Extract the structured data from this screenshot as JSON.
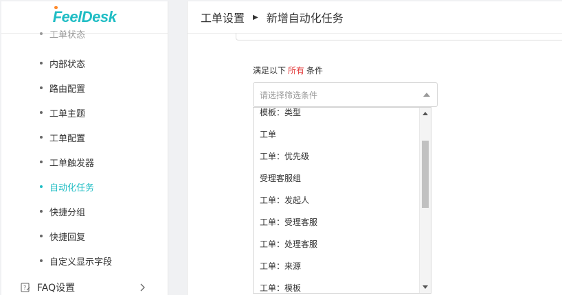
{
  "app": {
    "logo_text": "FeelDesk"
  },
  "sidebar": {
    "partial_item": "工单状态",
    "items": [
      {
        "label": "内部状态"
      },
      {
        "label": "路由配置"
      },
      {
        "label": "工单主题"
      },
      {
        "label": "工单配置"
      },
      {
        "label": "工单触发器"
      },
      {
        "label": "自动化任务",
        "active": true
      },
      {
        "label": "快捷分组"
      },
      {
        "label": "快捷回复"
      },
      {
        "label": "自定义显示字段"
      }
    ],
    "faq": {
      "label": "FAQ设置"
    }
  },
  "header": {
    "breadcrumb_parent": "工单设置",
    "separator": "▶",
    "breadcrumb_current": "新增自动化任务"
  },
  "condition": {
    "prefix": "满足以下",
    "highlight": "所有",
    "suffix": "条件",
    "highlight_color": "#e23b3b"
  },
  "select": {
    "placeholder": "请选择筛选条件"
  },
  "dropdown": {
    "options": [
      "模板：类型",
      "工单",
      "工单：优先级",
      "受理客服组",
      "工单：发起人",
      "工单：受理客服",
      "工单：处理客服",
      "工单：来源",
      "工单：模板"
    ]
  },
  "colors": {
    "accent": "#1fbdc4",
    "logo_dot": "#ff8a2b"
  }
}
